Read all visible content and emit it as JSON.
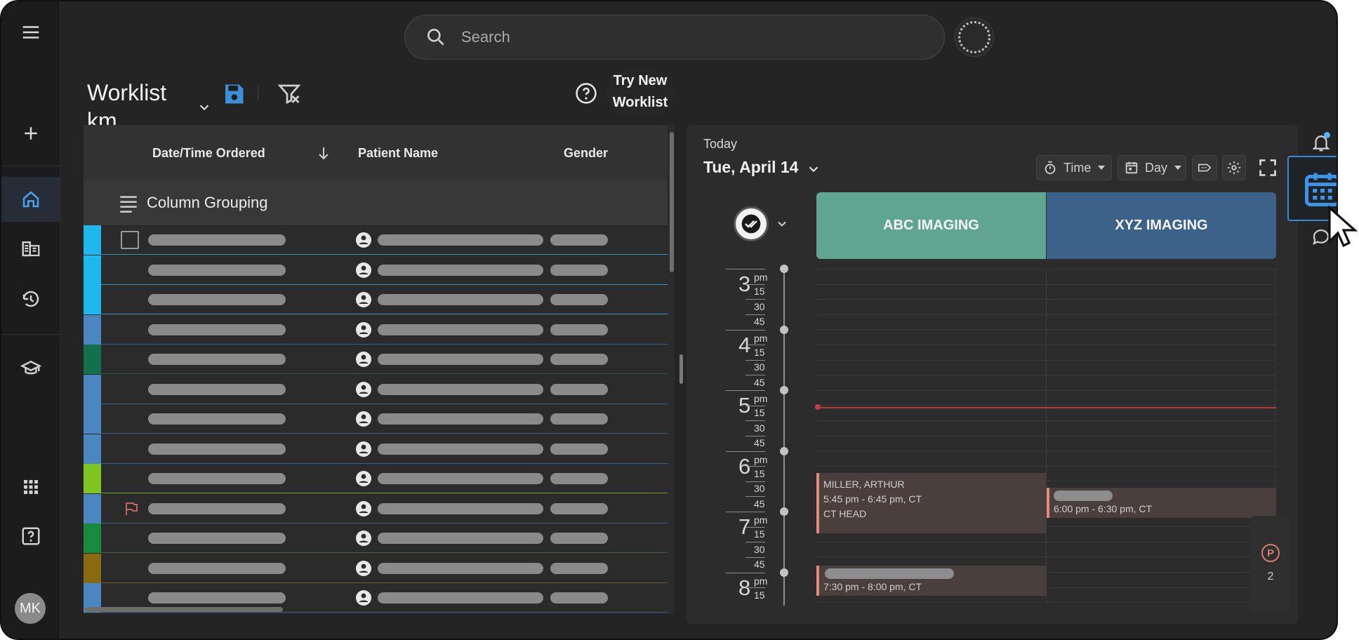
{
  "nav": {
    "items": [
      {
        "name": "menu-icon"
      },
      {
        "name": "add-icon"
      },
      {
        "name": "home-icon"
      },
      {
        "name": "worklist-icon"
      },
      {
        "name": "history-icon"
      },
      {
        "name": "school-icon"
      },
      {
        "name": "apps-icon"
      },
      {
        "name": "help-icon"
      }
    ],
    "avatar_initials": "MK"
  },
  "search": {
    "placeholder": "Search",
    "value": ""
  },
  "toolbar": {
    "title_line1": "Worklist",
    "title_line2": "km",
    "try_new_line1": "Try New",
    "try_new_line2": "Worklist"
  },
  "grid": {
    "columns": [
      "Date/Time Ordered",
      "Patient Name",
      "Gender"
    ],
    "sort_column": "Date/Time Ordered",
    "sort_direction": "descending",
    "grouping_label": "Column Grouping",
    "rows": [
      {
        "color": "#1fb8ee",
        "line": "#3a8fbf",
        "checkbox": true,
        "flag": false
      },
      {
        "color": "#1fb8ee",
        "line": "#3a8fbf",
        "checkbox": false,
        "flag": false
      },
      {
        "color": "#1fb8ee",
        "line": "#3a8fbf",
        "checkbox": false,
        "flag": false
      },
      {
        "color": "#4a86c0",
        "line": "#3b5f88",
        "checkbox": false,
        "flag": false
      },
      {
        "color": "#12704f",
        "line": "#2b5a44",
        "checkbox": false,
        "flag": false
      },
      {
        "color": "#4a86c0",
        "line": "#3b5f88",
        "checkbox": false,
        "flag": false
      },
      {
        "color": "#4a86c0",
        "line": "#3b5f88",
        "checkbox": false,
        "flag": false
      },
      {
        "color": "#4a86c0",
        "line": "#3b5f88",
        "checkbox": false,
        "flag": false
      },
      {
        "color": "#7fc51f",
        "line": "#6e9b2a",
        "checkbox": false,
        "flag": false
      },
      {
        "color": "#4a86c0",
        "line": "#3b5f88",
        "checkbox": false,
        "flag": true
      },
      {
        "color": "#178a3e",
        "line": "#2e6a45",
        "checkbox": false,
        "flag": false
      },
      {
        "color": "#8a6a10",
        "line": "#6b5a22",
        "checkbox": false,
        "flag": false
      },
      {
        "color": "#4a86c0",
        "line": "#3b5f88",
        "checkbox": false,
        "flag": false
      }
    ]
  },
  "schedule": {
    "today_label": "Today",
    "date_label": "Tue, April 14",
    "time_label": "Time",
    "view_label": "Day",
    "resources": [
      {
        "name": "ABC IMAGING",
        "color": "#5fa592"
      },
      {
        "name": "XYZ IMAGING",
        "color": "#3d6289"
      }
    ],
    "hours": [
      {
        "hour": "3",
        "suffix": "pm",
        "minutes": [
          "15",
          "30",
          "45"
        ]
      },
      {
        "hour": "4",
        "suffix": "pm",
        "minutes": [
          "15",
          "30",
          "45"
        ]
      },
      {
        "hour": "5",
        "suffix": "pm",
        "minutes": [
          "15",
          "30",
          "45"
        ]
      },
      {
        "hour": "6",
        "suffix": "pm",
        "minutes": [
          "15",
          "30",
          "45"
        ]
      },
      {
        "hour": "7",
        "suffix": "pm",
        "minutes": [
          "15",
          "30",
          "45"
        ]
      },
      {
        "hour": "8",
        "suffix": "pm",
        "minutes": [
          "15"
        ]
      }
    ],
    "appointments": [
      {
        "patient": "MILLER, ARTHUR",
        "time": "5:45 pm - 6:45 pm, CT",
        "procedure": "CT HEAD"
      },
      {
        "patient": "",
        "time": "6:00 pm - 6:30 pm, CT",
        "procedure": ""
      },
      {
        "patient": "",
        "time": "7:30 pm - 8:00 pm, CT",
        "procedure": ""
      }
    ],
    "pending_count": "2",
    "pending_badge": "P"
  },
  "colors": {
    "accent": "#4a9be0",
    "now_line": "#b23b3b",
    "background": "#242424"
  }
}
